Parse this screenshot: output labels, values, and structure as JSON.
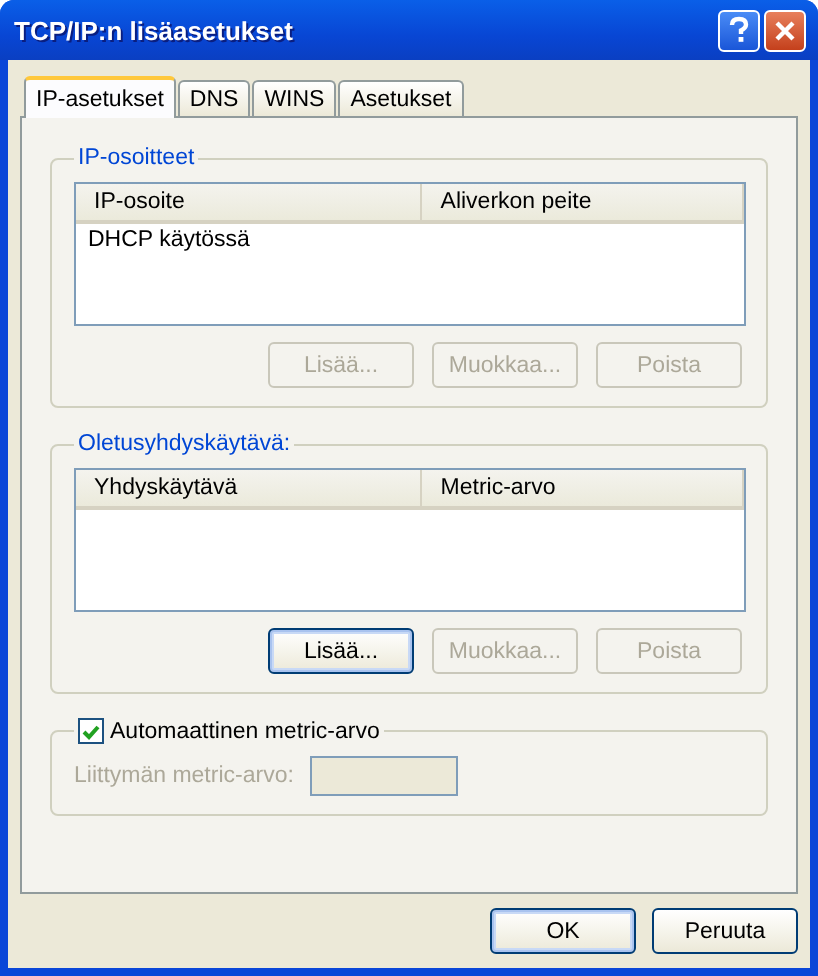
{
  "window": {
    "title": "TCP/IP:n lisäasetukset"
  },
  "tabs": [
    {
      "label": "IP-asetukset",
      "selected": true
    },
    {
      "label": "DNS",
      "selected": false
    },
    {
      "label": "WINS",
      "selected": false
    },
    {
      "label": "Asetukset",
      "selected": false
    }
  ],
  "ip_addresses": {
    "legend": "IP-osoitteet",
    "columns": [
      "IP-osoite",
      "Aliverkon peite"
    ],
    "rows": [
      [
        "DHCP käytössä"
      ]
    ],
    "buttons": [
      {
        "label": "Lisää...",
        "disabled": true,
        "focused": false
      },
      {
        "label": "Muokkaa...",
        "disabled": true,
        "focused": false
      },
      {
        "label": "Poista",
        "disabled": true,
        "focused": false
      }
    ]
  },
  "gateways": {
    "legend": "Oletusyhdyskäytävä:",
    "columns": [
      "Yhdyskäytävä",
      "Metric-arvo"
    ],
    "buttons": [
      {
        "label": "Lisää...",
        "disabled": false,
        "focused": true
      },
      {
        "label": "Muokkaa...",
        "disabled": true,
        "focused": false
      },
      {
        "label": "Poista",
        "disabled": true,
        "focused": false
      }
    ]
  },
  "metric": {
    "checkbox_label": "Automaattinen metric-arvo",
    "checked": true,
    "field_label": "Liittymän metric-arvo:",
    "field_disabled": true
  },
  "footer_buttons": [
    {
      "label": "OK",
      "focused": true
    },
    {
      "label": "Peruuta",
      "focused": false
    }
  ]
}
